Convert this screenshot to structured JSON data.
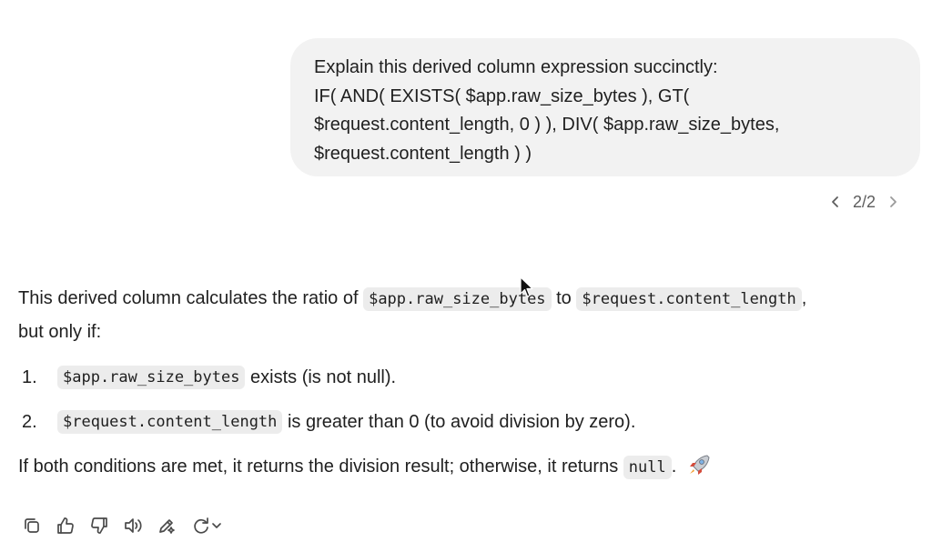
{
  "user_message": {
    "lines": [
      "Explain this derived column expression succinctly:",
      "IF( AND( EXISTS( $app.raw_size_bytes ), GT(",
      "$request.content_length, 0 ) ), DIV( $app.raw_size_bytes,",
      "$request.content_length ) )"
    ]
  },
  "pager": {
    "label": "2/2",
    "prev_icon": "chevron-left-icon",
    "next_icon": "chevron-right-icon"
  },
  "assistant": {
    "intro_prefix": "This derived column calculates the ratio of ",
    "intro_code1": "$app.raw_size_bytes",
    "intro_mid": " to ",
    "intro_code2": "$request.content_length",
    "intro_suffix": ",",
    "intro_line2": "but only if:",
    "items": [
      {
        "num": "1.",
        "code": "$app.raw_size_bytes",
        "text": " exists (is not null)."
      },
      {
        "num": "2.",
        "code": "$request.content_length",
        "text": " is greater than 0 (to avoid division by zero)."
      }
    ],
    "conclusion_prefix": "If both conditions are met, it returns the division result; otherwise, it returns ",
    "conclusion_code": "null",
    "conclusion_suffix": ".",
    "emoji_icon": "rocket-icon"
  },
  "actions": {
    "icons": [
      "copy-icon",
      "thumbs-up-icon",
      "thumbs-down-icon",
      "read-aloud-icon",
      "edit-icon",
      "regenerate-icon"
    ]
  }
}
